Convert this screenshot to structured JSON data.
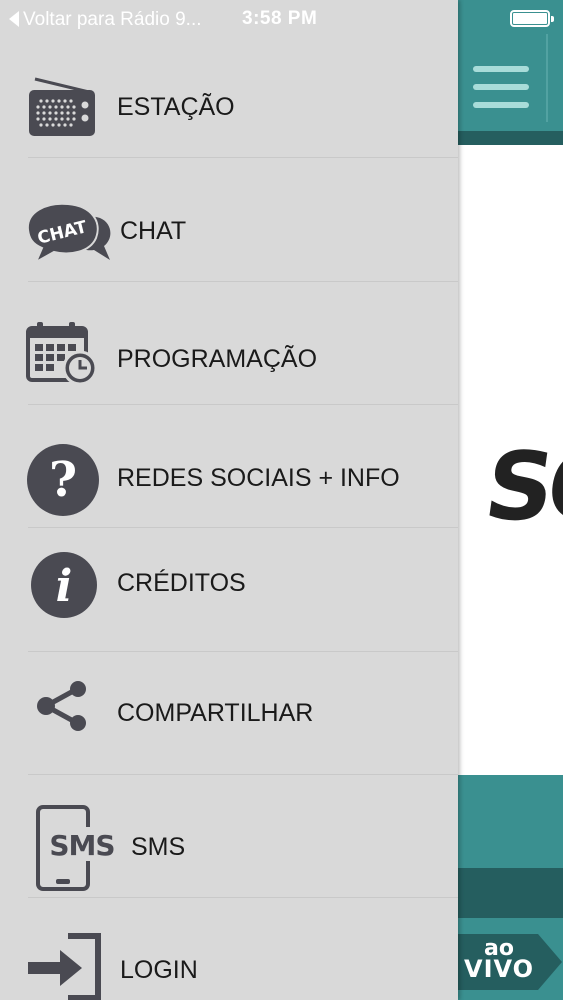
{
  "status_bar": {
    "back_label": "Voltar para Rádio 9...",
    "time": "3:58 PM",
    "battery_level": 1.0
  },
  "menu": {
    "items": [
      {
        "label": "ESTAÇÃO",
        "icon": "radio-icon"
      },
      {
        "label": "CHAT",
        "icon": "chat-bubble-icon",
        "icon_text": "CHAT"
      },
      {
        "label": "PROGRAMAÇÃO",
        "icon": "calendar-clock-icon"
      },
      {
        "label": "REDES SOCIAIS + INFO",
        "icon": "question-icon",
        "icon_text": "?"
      },
      {
        "label": "CRÉDITOS",
        "icon": "info-icon",
        "icon_text": "i"
      },
      {
        "label": "COMPARTILHAR",
        "icon": "share-icon"
      },
      {
        "label": "SMS",
        "icon": "sms-phone-icon",
        "icon_text": "SMS"
      },
      {
        "label": "LOGIN",
        "icon": "login-arrow-icon"
      }
    ]
  },
  "app": {
    "logo_text": "SO",
    "live_button": {
      "line1": "ao",
      "line2": "VIVO"
    }
  },
  "colors": {
    "drawer_bg": "#d9d9d9",
    "teal": "#3a9090",
    "teal_dark": "#255e5f",
    "icon_gray": "#4a4a52"
  }
}
